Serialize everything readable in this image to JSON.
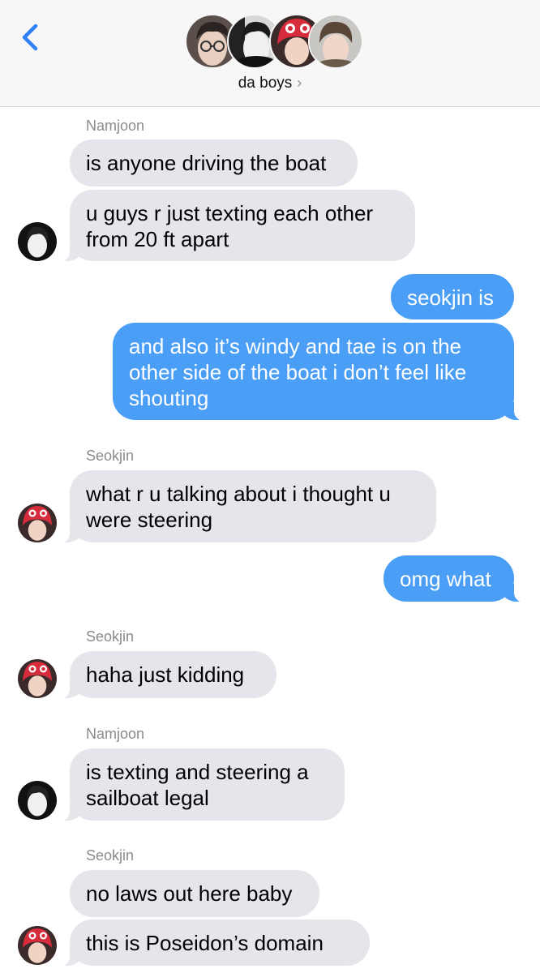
{
  "header": {
    "group_name": "da boys",
    "chevron": "›"
  },
  "avatars": [
    {
      "name": "avatar-glasses",
      "bg": "#5a4f4a",
      "skin": "#e9cfc0",
      "hair": "#2b2422"
    },
    {
      "name": "avatar-bw",
      "bg": "#d8d8d8",
      "skin": "#f0f0f0",
      "hair": "#1a1a1a"
    },
    {
      "name": "avatar-red-hat",
      "bg": "#b8243a",
      "skin": "#f1d3c4",
      "hair": "#d72c3c"
    },
    {
      "name": "avatar-light",
      "bg": "#c9c7c4",
      "skin": "#efd6c8",
      "hair": "#5a4636"
    }
  ],
  "messages": [
    {
      "sender": "Namjoon"
    },
    {
      "text_lines": [
        "is anyone driving the boat"
      ]
    },
    {
      "text_lines": [
        "u guys r just texting each other",
        "from 20 ft apart"
      ]
    },
    {
      "text_lines": [
        "seokjin is"
      ]
    },
    {
      "text_lines": [
        "and also it’s windy and tae is on the",
        "other side of the boat i don’t feel like",
        "shouting"
      ]
    },
    {
      "sender": "Seokjin"
    },
    {
      "text_lines": [
        "what r u talking about i thought u",
        "were steering"
      ]
    },
    {
      "text_lines": [
        "omg what"
      ]
    },
    {
      "sender": "Seokjin"
    },
    {
      "text_lines": [
        "haha just kidding"
      ]
    },
    {
      "sender": "Namjoon"
    },
    {
      "text_lines": [
        "is texting and steering a",
        "sailboat legal"
      ]
    },
    {
      "sender": "Seokjin"
    },
    {
      "text_lines": [
        "no laws out here baby"
      ]
    },
    {
      "text_lines": [
        "this is Poseidon’s domain"
      ]
    }
  ],
  "colors": {
    "incoming_bubble": "#e6e5eb",
    "outgoing_bubble": "#4a9ef5",
    "accent": "#2f7ff6",
    "sender_label": "#8a8a8f"
  }
}
